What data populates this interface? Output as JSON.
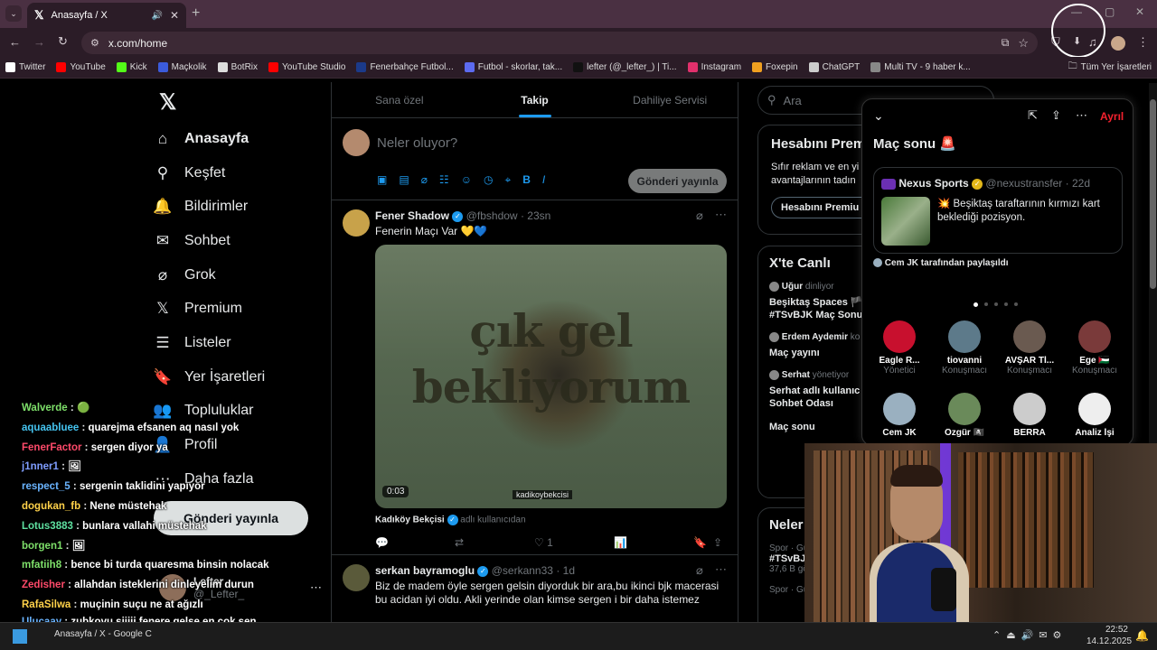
{
  "browser": {
    "tab_title": "Anasayfa / X",
    "url": "x.com/home",
    "bookmarks": [
      {
        "label": "Twitter",
        "color": "#ffffff"
      },
      {
        "label": "YouTube",
        "color": "#ff0000"
      },
      {
        "label": "Kick",
        "color": "#53fc18"
      },
      {
        "label": "Maçkolik",
        "color": "#3b5bdb"
      },
      {
        "label": "BotRix",
        "color": "#dddddd"
      },
      {
        "label": "YouTube Studio",
        "color": "#ff0000"
      },
      {
        "label": "Fenerbahçe Futbol...",
        "color": "#1b3a8a"
      },
      {
        "label": "Futbol - skorlar, tak...",
        "color": "#5c6bf0"
      },
      {
        "label": "lefter (@_lefter_) | Ti...",
        "color": "#111111"
      },
      {
        "label": "Instagram",
        "color": "#e1306c"
      },
      {
        "label": "Foxepin",
        "color": "#f0a020"
      },
      {
        "label": "ChatGPT",
        "color": "#cccccc"
      },
      {
        "label": "Multi TV - 9 haber k...",
        "color": "#888888"
      }
    ],
    "all_bookmarks": "Tüm Yer İşaretleri"
  },
  "nav": {
    "items": [
      {
        "label": "Anasayfa",
        "icon": "home-icon",
        "glyph": "⌂"
      },
      {
        "label": "Keşfet",
        "icon": "search-icon",
        "glyph": "⚲"
      },
      {
        "label": "Bildirimler",
        "icon": "bell-icon",
        "glyph": "🔔"
      },
      {
        "label": "Sohbet",
        "icon": "mail-icon",
        "glyph": "✉"
      },
      {
        "label": "Grok",
        "icon": "grok-icon",
        "glyph": "⌀"
      },
      {
        "label": "Premium",
        "icon": "x-icon",
        "glyph": "𝕏"
      },
      {
        "label": "Listeler",
        "icon": "list-icon",
        "glyph": "☰"
      },
      {
        "label": "Yer İşaretleri",
        "icon": "bookmark-icon",
        "glyph": "🔖"
      },
      {
        "label": "Topluluklar",
        "icon": "people-icon",
        "glyph": "👥"
      },
      {
        "label": "Profil",
        "icon": "profile-icon",
        "glyph": "👤"
      },
      {
        "label": "Daha fazla",
        "icon": "more-icon",
        "glyph": "⋯"
      }
    ],
    "post_button": "Gönderi yayınla",
    "account_name": "Lefter",
    "account_handle": "@_Lefter_"
  },
  "feed": {
    "tabs": [
      "Sana özel",
      "Takip",
      "Dahiliye Servisi"
    ],
    "active_tab": "Takip",
    "composer_placeholder": "Neler oluyor?",
    "post_button": "Gönderi yayınla",
    "tweets": [
      {
        "name": "Fener Shadow",
        "handle": "@fbshdow",
        "time": "23sn",
        "text": "Fenerin Maçı Var 💛💙",
        "video_overlay_line1": "çık gel",
        "video_overlay_line2": "bekliyorum",
        "video_time": "0:03",
        "video_credit": "kadikoybekcisi",
        "attribution_name": "Kadıköy Bekçisi",
        "attribution_suffix": "adlı kullanıcıdan",
        "likes": "1"
      },
      {
        "name": "serkan bayramoglu",
        "handle": "@serkann33",
        "time": "1d",
        "text": "Biz de madem öyle sergen gelsin diyorduk bir ara,bu ikinci bjk macerasi bu acidan iyi oldu. Akli yerinde olan kimse sergen i bir daha istemez"
      }
    ]
  },
  "right": {
    "search_placeholder": "Ara",
    "premium_title": "Hesabını Prem",
    "premium_body": "Sıfır reklam ve en yi avantajlarının tadın",
    "premium_button": "Hesabını Premiu",
    "live_title": "X'te Canlı",
    "live_items": [
      {
        "host": "Uğur",
        "role": "dinliyor",
        "title": "Beşiktaş Spaces 🏴 #TSvBJK Maç Sonu"
      },
      {
        "host": "Erdem Aydemir",
        "role": "ko",
        "title": "Maç yayını"
      },
      {
        "host": "Serhat",
        "role": "yönetiyor",
        "title": "Serhat adlı kullanıc Sohbet Odası"
      },
      {
        "host": "",
        "role": "",
        "title": "Maç sonu"
      }
    ],
    "news_title": "Neler",
    "news_items": [
      {
        "meta": "Spor · Gü",
        "title": "#TSvBJ",
        "count": "37,6 B gö"
      },
      {
        "meta": "Spor · Gü",
        "title": "",
        "count": ""
      }
    ]
  },
  "space": {
    "leave": "Ayrıl",
    "title": "Maç sonu 🚨",
    "pinned_name": "Nexus Sports",
    "pinned_handle": "@nexustransfer",
    "pinned_time": "22d",
    "pinned_text": "💥 Beşiktaş taraftarının kırmızı kart beklediği pozisyon.",
    "shared_by": "Cem JK tarafından paylaşıldı",
    "speakers": [
      {
        "name": "Eagle R...",
        "role": "Yönetici",
        "color": "#c8102e"
      },
      {
        "name": "tiovanni",
        "role": "Konuşmacı",
        "color": "#5d7a8a"
      },
      {
        "name": "AVŞAR Tİ...",
        "role": "Konuşmacı",
        "color": "#6a5a50"
      },
      {
        "name": "Ege 🇵🇸",
        "role": "Konuşmacı",
        "color": "#7a3a3a"
      },
      {
        "name": "Cem JK",
        "role": "",
        "color": "#9ab0c0"
      },
      {
        "name": "Özgür 🏴‍☠️",
        "role": "",
        "color": "#6a8a5a"
      },
      {
        "name": "BERRA",
        "role": "",
        "color": "#cccccc"
      },
      {
        "name": "Analiz İşi",
        "role": "",
        "color": "#eeeeee"
      }
    ]
  },
  "chat": [
    {
      "user": "Walverde",
      "msg": "🟢",
      "color": "#7ee06a"
    },
    {
      "user": "aquaabluee",
      "msg": "quarejma efsanen aq nasıl yok",
      "color": "#45c4f0"
    },
    {
      "user": "FenerFactor",
      "msg": "sergen diyor ya",
      "color": "#ff4a6a"
    },
    {
      "user": "j1nner1",
      "msg": "🖼",
      "color": "#7f9dff"
    },
    {
      "user": "respect_5",
      "msg": "sergenin taklidini yapıyor",
      "color": "#6ab4ff"
    },
    {
      "user": "dogukan_fb",
      "msg": "Nene müstehak",
      "color": "#ffd24a"
    },
    {
      "user": "Lotus3883",
      "msg": "bunlara vallahi müstehak",
      "color": "#5ee0a0"
    },
    {
      "user": "borgen1",
      "msg": "🖼",
      "color": "#7ee06a"
    },
    {
      "user": "mfatiih8",
      "msg": "bence bi turda quaresma binsin nolacak",
      "color": "#7ee06a"
    },
    {
      "user": "Zedisher",
      "msg": "allahdan isteklerini dinleyelim durun",
      "color": "#ff4a6a"
    },
    {
      "user": "RafaSilwa",
      "msg": "muçinin suçu ne at ağızlı",
      "color": "#ffd24a"
    },
    {
      "user": "Ulucaay",
      "msg": "zubkovu siiiii fenere gelse en çok sen sövwrsin lefoooo",
      "color": "#6ab4ff"
    }
  ],
  "taskbar": {
    "app_title": "Anasayfa / X - Google C",
    "time": "22:52",
    "date": "14.12.2025"
  }
}
